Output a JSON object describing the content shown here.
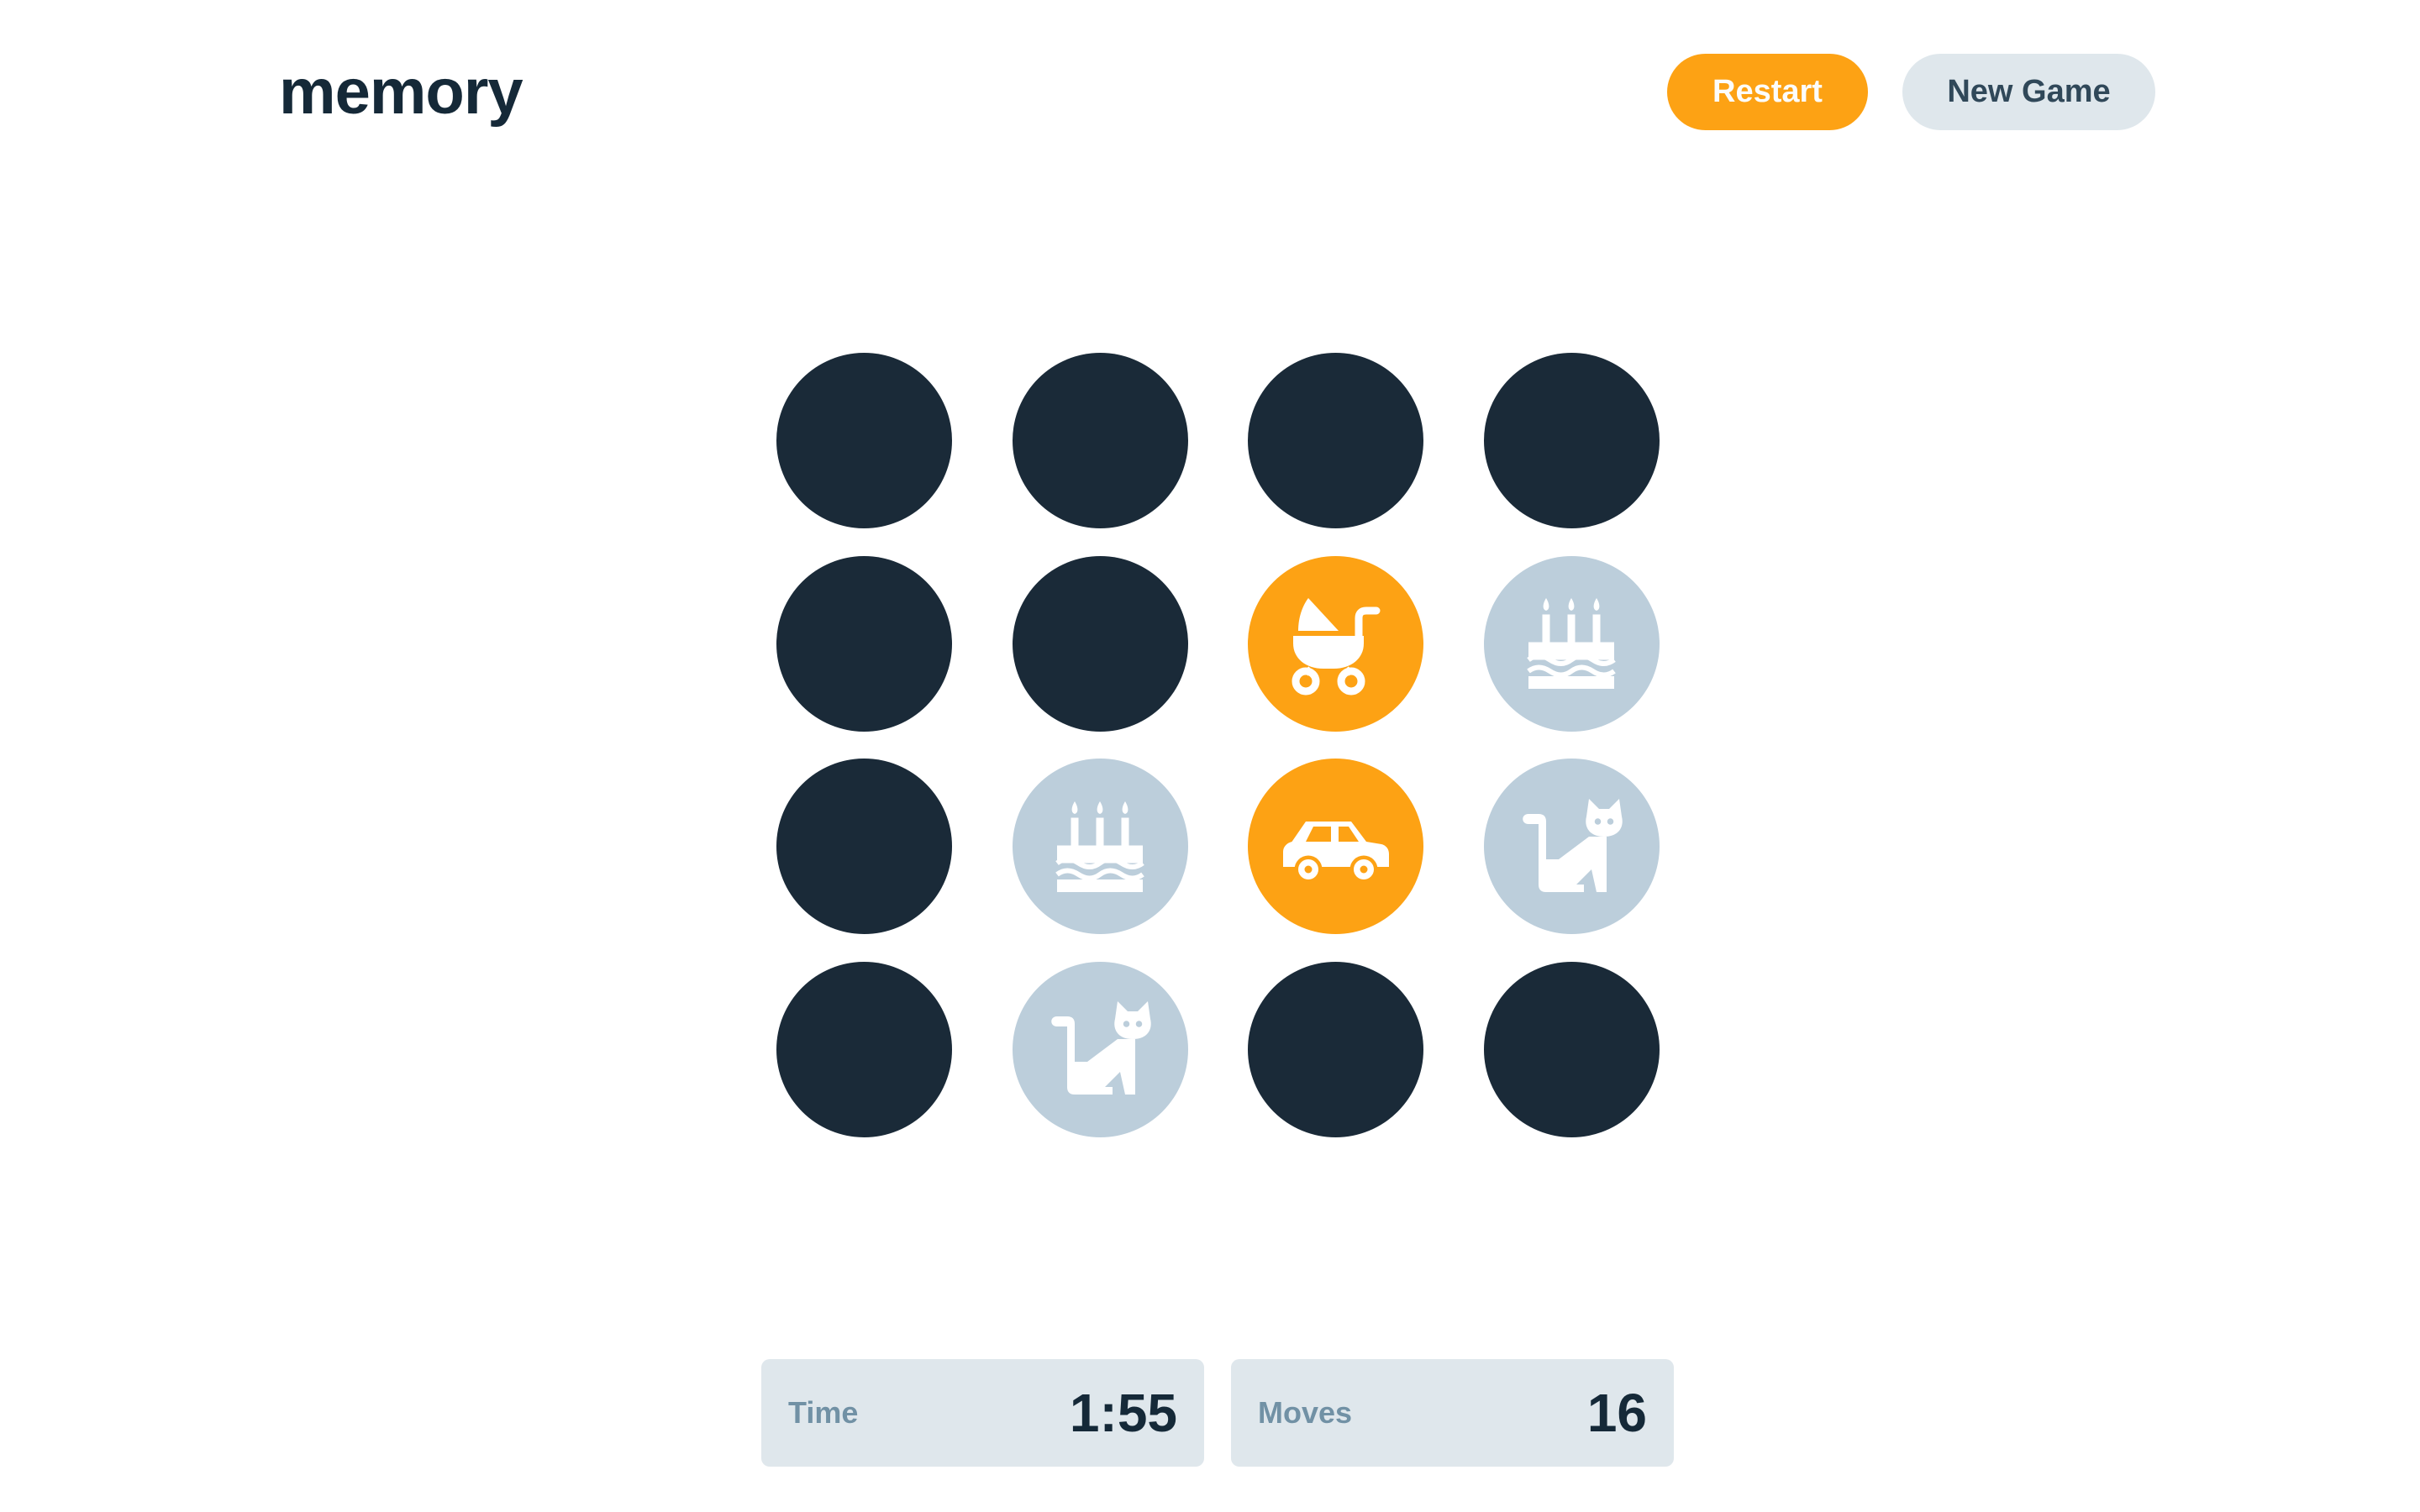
{
  "header": {
    "title": "memory",
    "restart_label": "Restart",
    "new_game_label": "New Game"
  },
  "board": {
    "rows": 4,
    "cols": 4,
    "cells": [
      {
        "state": "hidden",
        "icon": ""
      },
      {
        "state": "hidden",
        "icon": ""
      },
      {
        "state": "hidden",
        "icon": ""
      },
      {
        "state": "hidden",
        "icon": ""
      },
      {
        "state": "hidden",
        "icon": ""
      },
      {
        "state": "hidden",
        "icon": ""
      },
      {
        "state": "active",
        "icon": "stroller-icon"
      },
      {
        "state": "matched",
        "icon": "birthday-cake-icon"
      },
      {
        "state": "hidden",
        "icon": ""
      },
      {
        "state": "matched",
        "icon": "birthday-cake-icon"
      },
      {
        "state": "active",
        "icon": "car-icon"
      },
      {
        "state": "matched",
        "icon": "cat-icon"
      },
      {
        "state": "hidden",
        "icon": ""
      },
      {
        "state": "matched",
        "icon": "cat-icon"
      },
      {
        "state": "hidden",
        "icon": ""
      },
      {
        "state": "hidden",
        "icon": ""
      }
    ]
  },
  "stats": {
    "time_label": "Time",
    "time_value": "1:55",
    "moves_label": "Moves",
    "moves_value": "16"
  },
  "colors": {
    "hidden": "#1a2a38",
    "active": "#fda214",
    "matched": "#bccedb",
    "accent": "#fda214",
    "dark": "#152938"
  }
}
